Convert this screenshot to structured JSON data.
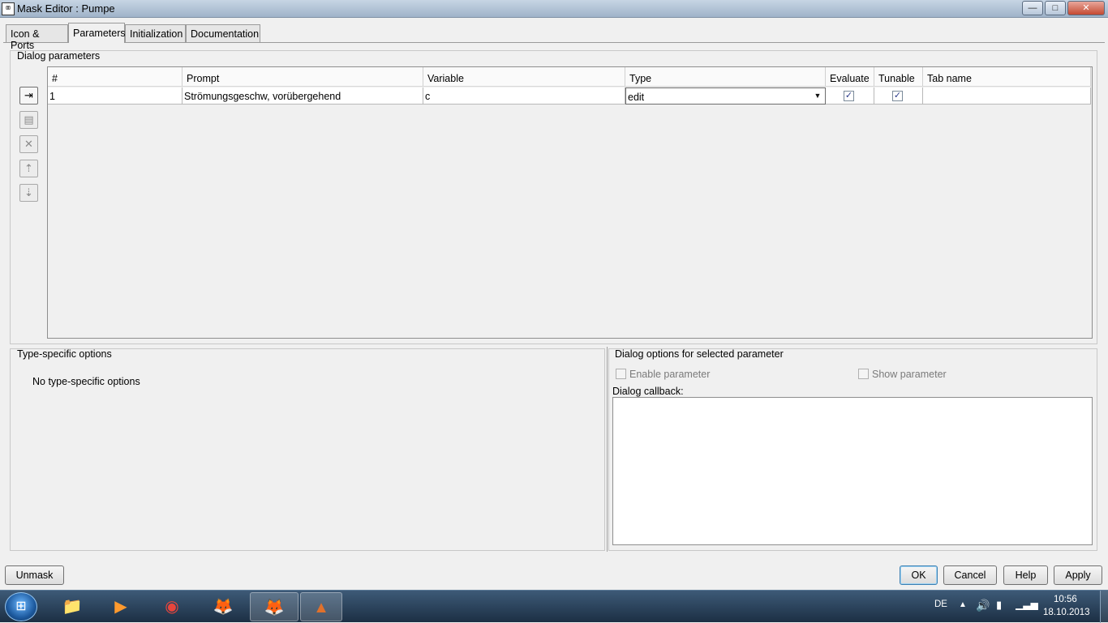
{
  "window": {
    "title": "Mask Editor : Pumpe",
    "icon": "simulink-app-icon"
  },
  "titlebar_buttons": {
    "minimize": "—",
    "maximize": "□",
    "close": "✕"
  },
  "tabs": [
    {
      "label": "Icon & Ports",
      "active": false
    },
    {
      "label": "Parameters",
      "active": true
    },
    {
      "label": "Initialization",
      "active": false
    },
    {
      "label": "Documentation",
      "active": false
    }
  ],
  "dialog_parameters": {
    "title": "Dialog parameters",
    "columns": [
      "#",
      "Prompt",
      "Variable",
      "Type",
      "Evaluate",
      "Tunable",
      "Tab name"
    ],
    "rows": [
      {
        "index": "1",
        "prompt": "Strömungsgeschw, vorübergehend",
        "variable": "c",
        "type": "edit",
        "evaluate": true,
        "tunable": true,
        "tab_name": ""
      }
    ],
    "toolbar": [
      {
        "name": "add-parameter-button-icon",
        "glyph": "⇥",
        "enabled": true
      },
      {
        "name": "copy-parameter-button-icon",
        "glyph": "▤",
        "enabled": false
      },
      {
        "name": "delete-parameter-button-icon",
        "glyph": "✕",
        "enabled": false
      },
      {
        "name": "move-up-button-icon",
        "glyph": "⇡",
        "enabled": false
      },
      {
        "name": "move-down-button-icon",
        "glyph": "⇣",
        "enabled": false
      }
    ]
  },
  "type_specific": {
    "title": "Type-specific options",
    "message": "No type-specific options"
  },
  "dialog_options": {
    "title": "Dialog options for selected parameter",
    "enable_parameter": "Enable parameter",
    "show_parameter": "Show parameter",
    "callback_label": "Dialog callback:",
    "callback_value": ""
  },
  "buttons": {
    "unmask": "Unmask",
    "ok": "OK",
    "cancel": "Cancel",
    "help": "Help",
    "apply": "Apply"
  },
  "taskbar": {
    "apps": [
      {
        "name": "windows-explorer-icon",
        "glyph": "📁",
        "active": false
      },
      {
        "name": "media-player-icon",
        "glyph": "▶",
        "active": false
      },
      {
        "name": "chrome-icon",
        "glyph": "◉",
        "active": false
      },
      {
        "name": "firefox-icon",
        "glyph": "🦊",
        "active": false
      },
      {
        "name": "firefox-window-icon",
        "glyph": "🦊",
        "active": true
      },
      {
        "name": "matlab-icon",
        "glyph": "▲",
        "active": true
      }
    ],
    "language": "DE",
    "time": "10:56",
    "date": "18.10.2013"
  }
}
